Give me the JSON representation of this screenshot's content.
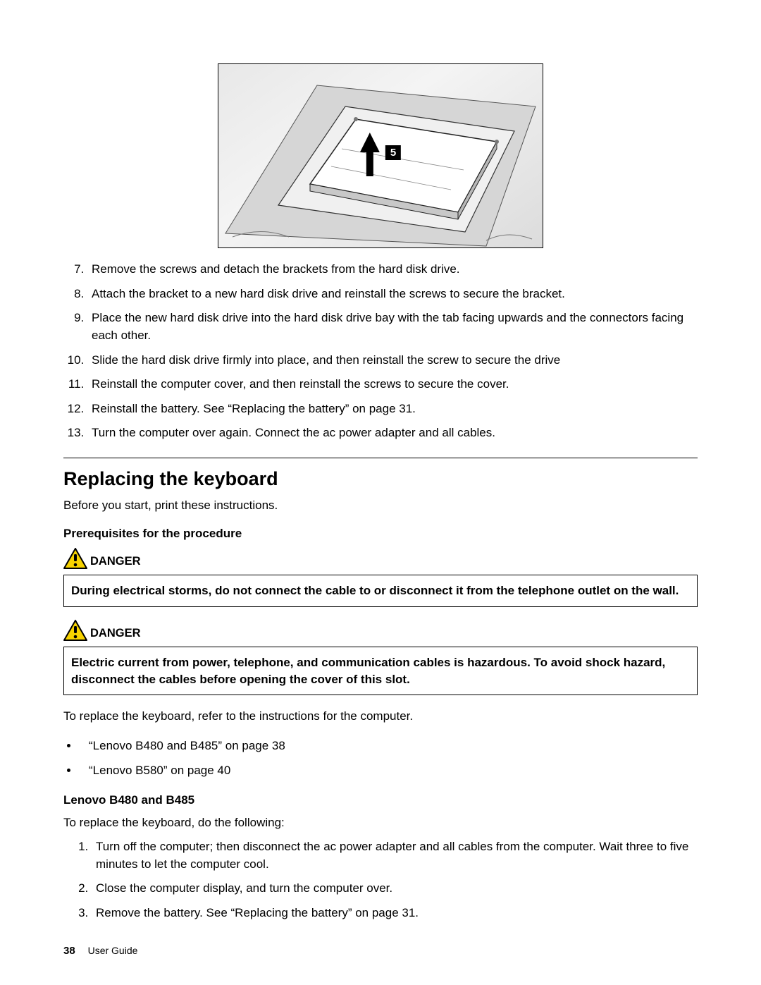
{
  "figure": {
    "callout": "5"
  },
  "steps_top": [
    "Remove the screws and detach the brackets from the hard disk drive.",
    "Attach the bracket to a new hard disk drive and reinstall the screws to secure the bracket.",
    "Place the new hard disk drive into the hard disk drive bay with the tab facing upwards and the connectors facing each other.",
    "Slide the hard disk drive firmly into place, and then reinstall the screw to secure the drive",
    "Reinstall the computer cover, and then reinstall the screws to secure the cover.",
    "Reinstall the battery. See “Replacing the battery” on page 31.",
    "Turn the computer over again. Connect the ac power adapter and all cables."
  ],
  "section_title": "Replacing the keyboard",
  "intro": "Before you start, print these instructions.",
  "prereq_heading": "Prerequisites for the procedure",
  "danger_label": "DANGER",
  "danger1": "During electrical storms, do not connect the cable to or disconnect it from the telephone outlet on the wall.",
  "danger2": "Electric current from power, telephone, and communication cables is hazardous. To avoid shock hazard, disconnect the cables before opening the cover of this slot.",
  "refer_text": "To replace the keyboard, refer to the instructions for the computer.",
  "refs": [
    "“Lenovo B480 and B485” on page 38",
    "“Lenovo B580” on page 40"
  ],
  "model_heading": "Lenovo B480 and B485",
  "model_intro": "To replace the keyboard, do the following:",
  "model_steps": [
    "Turn off the computer; then disconnect the ac power adapter and all cables from the computer. Wait three to five minutes to let the computer cool.",
    "Close the computer display, and turn the computer over.",
    "Remove the battery. See “Replacing the battery” on page 31."
  ],
  "footer": {
    "page": "38",
    "title": "User Guide"
  }
}
